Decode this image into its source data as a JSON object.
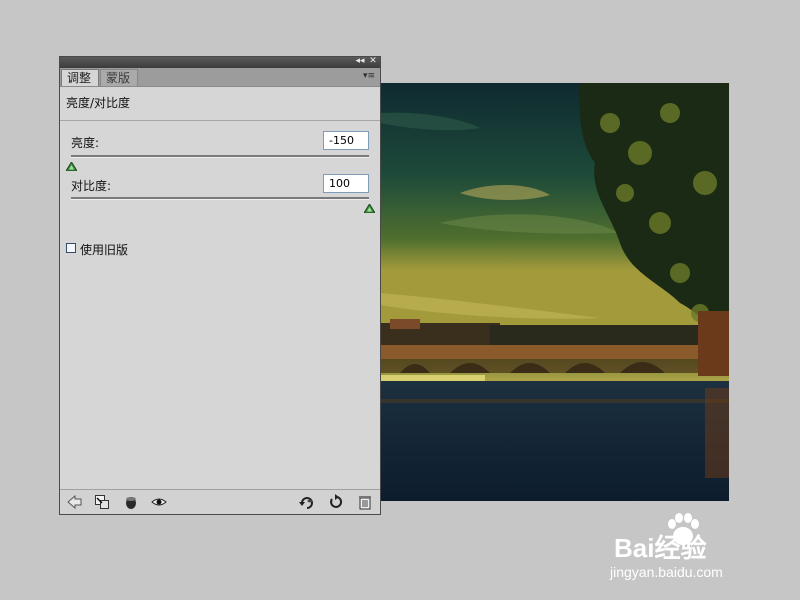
{
  "window": {
    "collapse_glyph": "◂◂",
    "close_glyph": "✕"
  },
  "tabs": [
    {
      "label": "调整",
      "active": true
    },
    {
      "label": "蒙版",
      "active": false
    }
  ],
  "panel_menu_glyph": "▾≡",
  "section_title": "亮度/对比度",
  "brightness": {
    "label": "亮度:",
    "value": "-150",
    "slider_fraction": 0.0
  },
  "contrast": {
    "label": "对比度:",
    "value": "100",
    "slider_fraction": 1.0
  },
  "legacy": {
    "label": "使用旧版",
    "checked": false
  },
  "bottom_toolbar": {
    "left_icons": [
      "back-arrow-icon",
      "clip-to-layer-icon",
      "visibility-mask-icon",
      "eye-icon"
    ],
    "right_icons": [
      "view-previous-state-icon",
      "reset-icon",
      "trash-icon"
    ]
  },
  "colors": {
    "slider_thumb": "#3a8a3a",
    "panel_bg": "#d6d6d6",
    "canvas_bg": "#c6c6c6"
  },
  "watermark": {
    "brand": "Bai经验",
    "url": "jingyan.baidu.com"
  }
}
